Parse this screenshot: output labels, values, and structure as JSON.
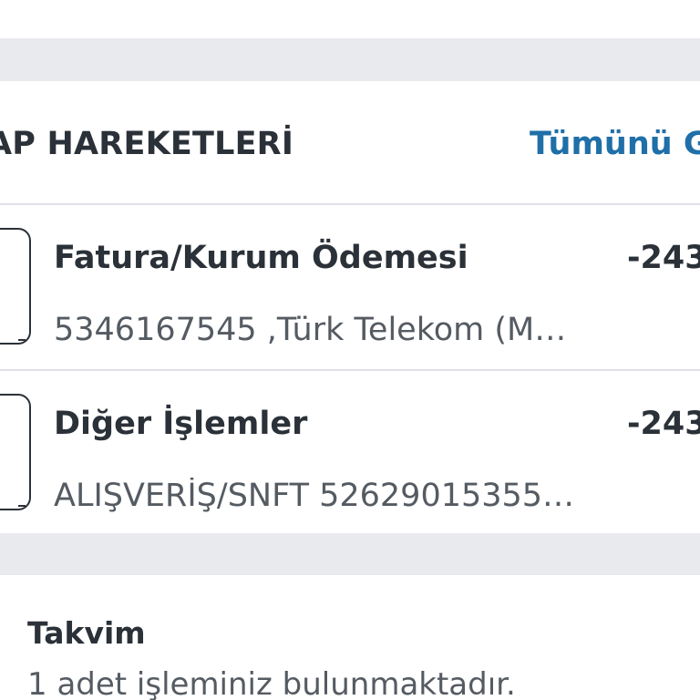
{
  "account_transactions": {
    "title": "AP HAREKETLERİ",
    "see_all_label": "Tümünü G",
    "items": [
      {
        "name": "Fatura/Kurum Ödemesi",
        "description": "5346167545 ,Türk Telekom (M…",
        "amount": "-243"
      },
      {
        "name": "Diğer İşlemler",
        "description": "ALIŞVERİŞ/SNFT 52629015355…",
        "amount": "-243"
      }
    ]
  },
  "calendar": {
    "title": "Takvim",
    "subtitle": "1 adet işleminiz bulunmaktadır."
  },
  "colors": {
    "accent": "#1f6fa8",
    "background": "#e9eaee",
    "card": "#ffffff",
    "text": "#2b3138",
    "text_secondary": "#555b62"
  },
  "icons": {
    "transaction_icon": "transaction-icon"
  }
}
